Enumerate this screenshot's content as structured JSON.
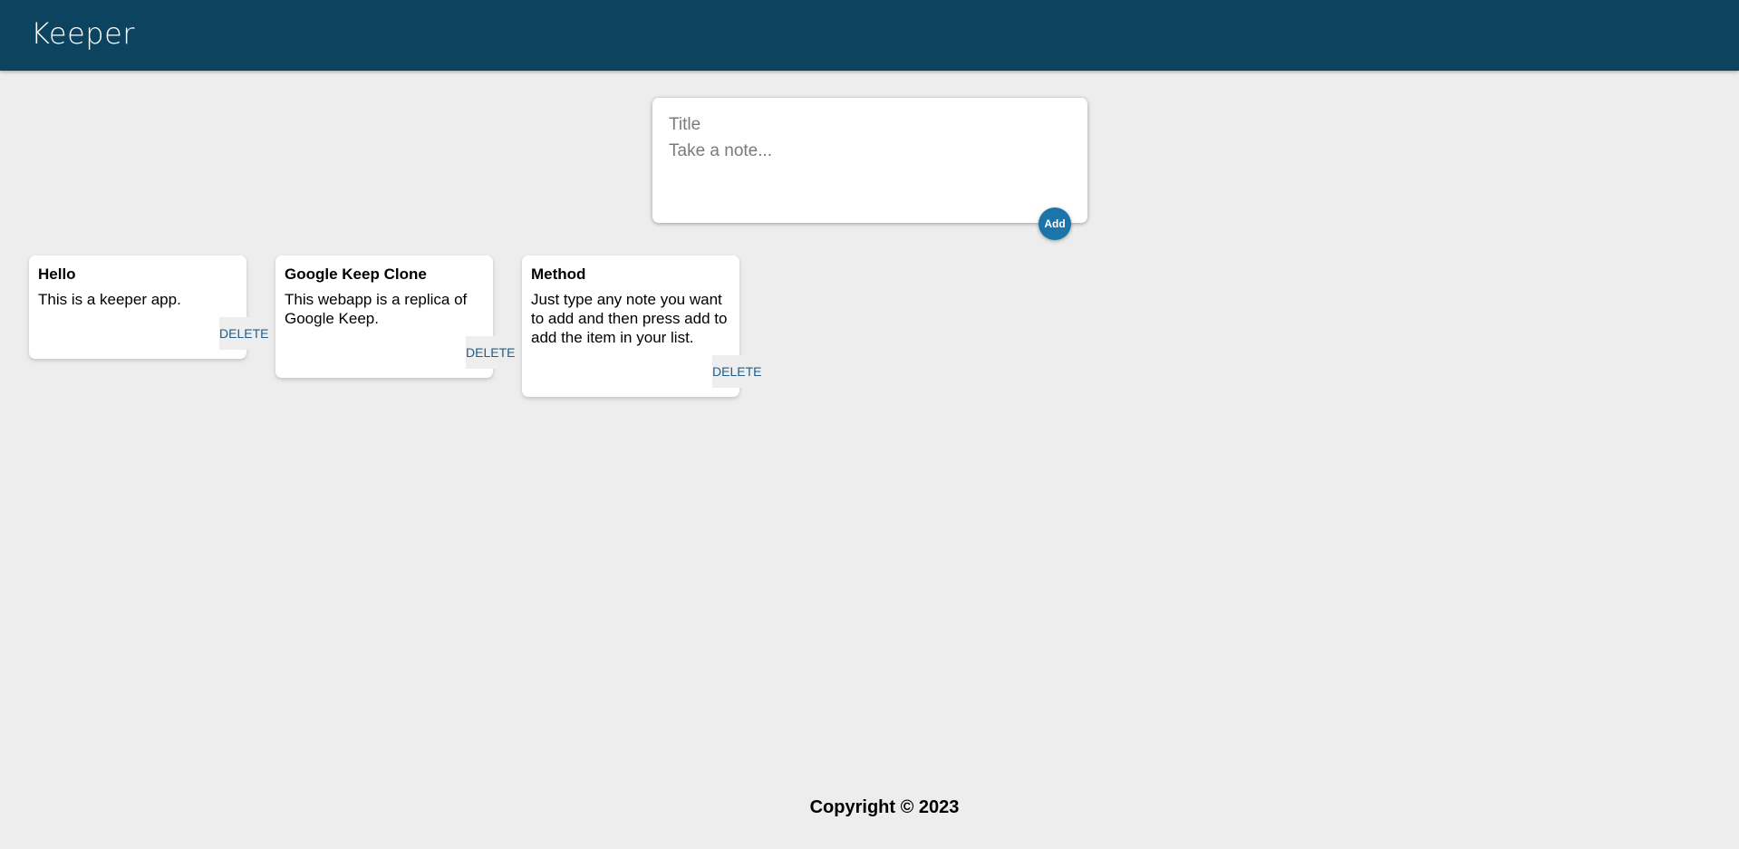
{
  "header": {
    "app_name": "Keeper"
  },
  "compose": {
    "title_placeholder": "Title",
    "content_placeholder": "Take a note...",
    "add_label": "Add"
  },
  "notes": [
    {
      "title": "Hello",
      "content": "This is a keeper app.",
      "delete_label": "DELETE"
    },
    {
      "title": "Google Keep Clone",
      "content": "This webapp is a replica of Google Keep.",
      "delete_label": "DELETE"
    },
    {
      "title": "Method",
      "content": "Just type any note you want to add and then press add to add the item in your list.",
      "delete_label": "DELETE"
    }
  ],
  "footer": {
    "copyright": "Copyright © 2023"
  },
  "colors": {
    "header_bg": "#0c4460",
    "page_bg": "#ededed",
    "accent": "#1b75a8",
    "delete_text": "#235e84"
  }
}
